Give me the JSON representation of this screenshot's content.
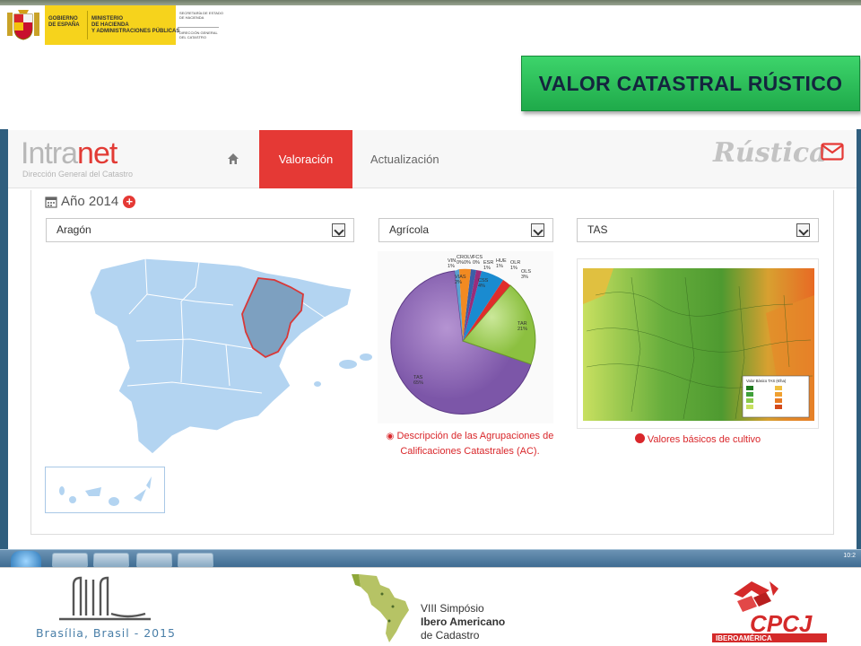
{
  "header": {
    "gov_left": "GOBIERNO\nDE ESPAÑA",
    "gov_ministry": "MINISTERIO\nDE HACIENDA\nY ADMINISTRACIONES PÚBLICAS",
    "gov_secretaria": "SECRETARÍA DE ESTADO\nDE HACIENDA",
    "gov_direccion": "DIRECCIÓN GENERAL\nDEL CATASTRO",
    "slide_title": "VALOR CATASTRAL RÚSTICO"
  },
  "app": {
    "brand": "Intranet",
    "brand_sub": "Dirección General del Catastro",
    "nav": {
      "home_icon": "home-icon",
      "valoracion": "Valoración",
      "actualizacion": "Actualización"
    },
    "section": "Rústica",
    "mail_icon": "envelope-icon",
    "accent": "#e53935"
  },
  "panel": {
    "year": "Año 2014",
    "filters": {
      "region": "Aragón",
      "use": "Agrícola",
      "crop": "TAS"
    },
    "pie_caption": "Descripción de las Agrupaciones de Calificaciones Catastrales (AC).",
    "map_caption": "Valores básicos de cultivo",
    "map_legend_title": "Valor Básico TAS (€/ha)"
  },
  "pie": {
    "labels": {
      "vin": "VIN\n1%",
      "cr": "CR\n0%",
      "olv": "OLV\n0%",
      "fcs": "FCS\n0%",
      "esr": "ESR\n1%",
      "hue": "HUE\n1%",
      "olr": "OLR\n1%",
      "ols": "OLS\n3%",
      "vias": "VIAS\n2%",
      "css": "CSS\n4%",
      "tar": "TAR\n21%",
      "tas": "TAS\n65%"
    }
  },
  "footer": {
    "city": "Brasília, Brasil - 2015",
    "symposium_line1": "VIII Simpósio",
    "symposium_line2": "Ibero Americano",
    "symposium_line3": "de Cadastro",
    "cpcj": "CPCJ",
    "cpcj_sub": "IBEROAMÉRICA"
  },
  "taskbar": {
    "clock": "10:2"
  }
}
